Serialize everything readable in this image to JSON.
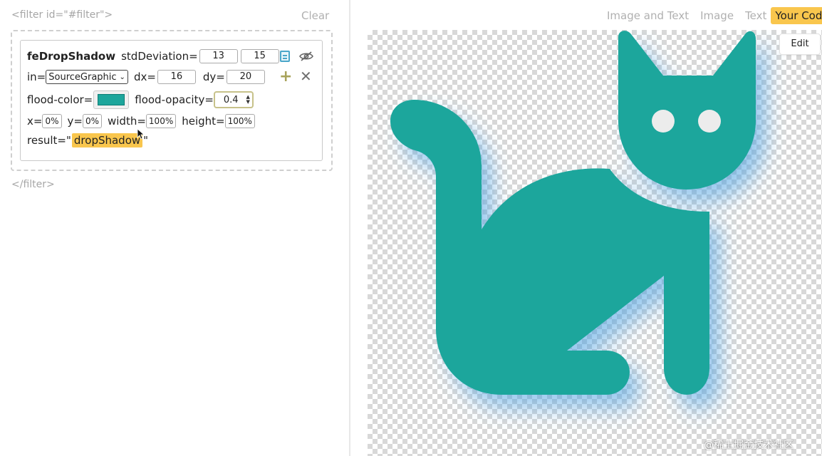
{
  "editor": {
    "filter_open": "<filter id=\"#filter\">",
    "filter_close": "</filter>",
    "clear_label": "Clear",
    "primitive": {
      "name": "feDropShadow",
      "std_label": "stdDeviation=",
      "std_x": "13",
      "std_y": "15",
      "in_label": "in=",
      "in_value": "SourceGraphic",
      "dx_label": "dx=",
      "dx_value": "16",
      "dy_label": "dy=",
      "dy_value": "20",
      "flood_color_label": "flood-color=",
      "flood_color": "#1ea69c",
      "flood_opacity_label": "flood-opacity=",
      "flood_opacity": "0.4",
      "x_label": "x=",
      "x_value": "0%",
      "y_label": "y=",
      "y_value": "0%",
      "width_label": "width=",
      "width_value": "100%",
      "height_label": "height=",
      "height_value": "100%",
      "result_label": "result=\"",
      "result_value": "dropShadow",
      "result_close": "\""
    },
    "icons": [
      "document-icon",
      "eye-off-icon",
      "plus-icon",
      "close-icon"
    ]
  },
  "preview": {
    "tabs": [
      {
        "label": "Image and Text",
        "active": false
      },
      {
        "label": "Image",
        "active": false
      },
      {
        "label": "Text",
        "active": false
      },
      {
        "label": "Your Code",
        "active": true
      }
    ],
    "edit_label": "Edit",
    "cat_color": "#1ea69c",
    "shadow_color": "#4a9fe0",
    "watermark": "@稀土掘金技术社区"
  }
}
